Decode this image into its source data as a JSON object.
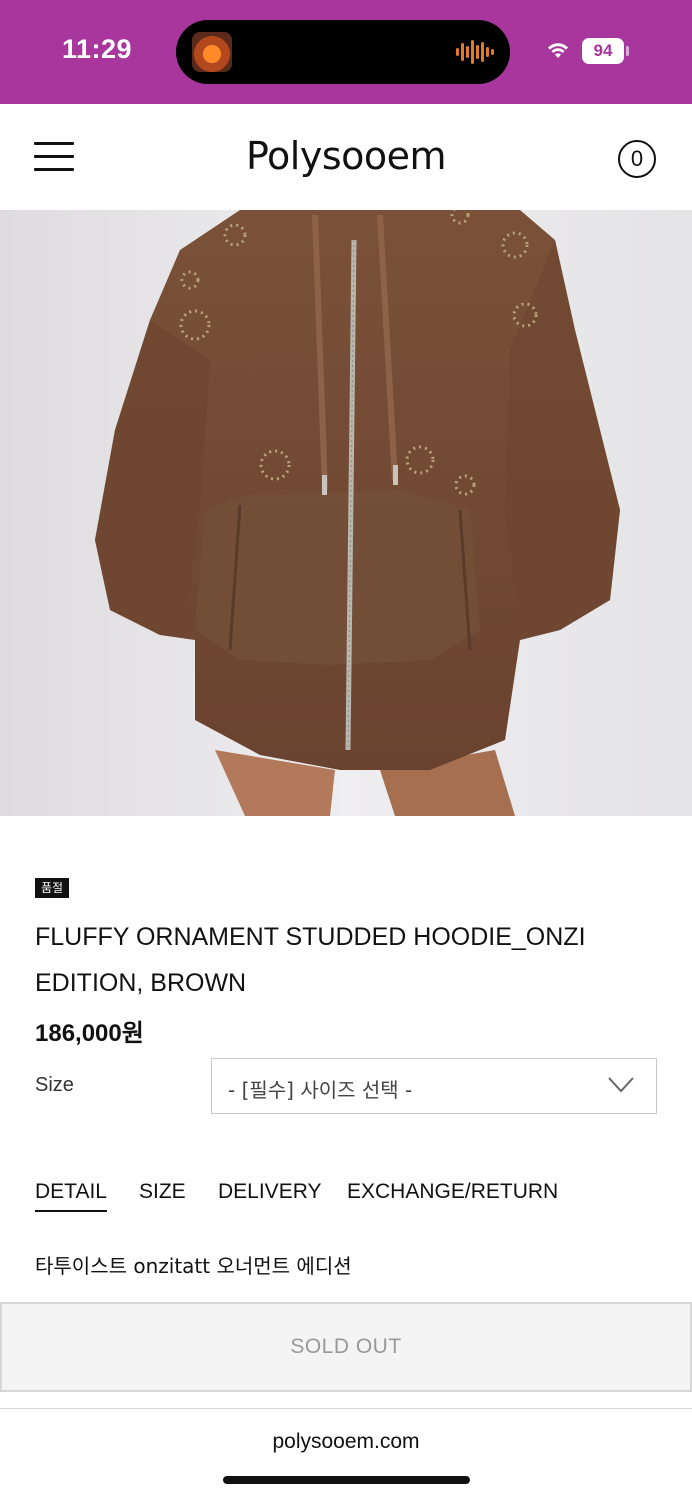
{
  "status_bar": {
    "time": "11:29",
    "battery": "94",
    "background_color": "#a8369c",
    "icons": [
      "music-thumbnail-icon",
      "audio-waveform-icon",
      "wifi-icon",
      "battery-icon"
    ]
  },
  "header": {
    "logo": "Polysooem",
    "cart_count": "0",
    "icons": [
      "hamburger-menu-icon",
      "cart-icon"
    ]
  },
  "product": {
    "image_alt": "Brown fluffy studded zip-up hoodie",
    "badge": "품절",
    "title": "FLUFFY ORNAMENT STUDDED HOODIE_ONZI EDITION, BROWN",
    "price": "186,000원",
    "size_label": "Size",
    "size_select_value": "- [필수] 사이즈 선택 -"
  },
  "tabs": [
    {
      "label": "DETAIL",
      "active": true
    },
    {
      "label": "SIZE",
      "active": false
    },
    {
      "label": "DELIVERY",
      "active": false
    },
    {
      "label": "EXCHANGE/RETURN",
      "active": false
    }
  ],
  "detail": {
    "text": "타투이스트 onzitatt 오너먼트 에디션"
  },
  "cta": {
    "label": "SOLD OUT"
  },
  "browser": {
    "url": "polysooem.com"
  }
}
